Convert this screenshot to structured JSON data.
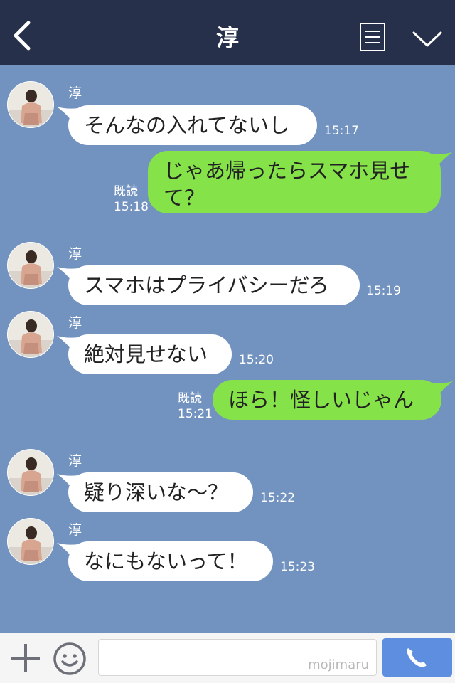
{
  "header": {
    "title": "淳"
  },
  "messages": [
    {
      "direction": "in",
      "sender": "淳",
      "text": "そんなの入れてないし",
      "time": "15:17"
    },
    {
      "direction": "out",
      "read": "既読",
      "text": "じゃあ帰ったらスマホ見せて？",
      "time": "15:18"
    },
    {
      "direction": "in",
      "sender": "淳",
      "text": "スマホはプライバシーだろ",
      "time": "15:19"
    },
    {
      "direction": "in",
      "sender": "淳",
      "text": "絶対見せない",
      "time": "15:20"
    },
    {
      "direction": "out",
      "read": "既読",
      "text": "ほら！怪しいじゃん",
      "time": "15:21"
    },
    {
      "direction": "in",
      "sender": "淳",
      "text": "疑り深いな〜？",
      "time": "15:22"
    },
    {
      "direction": "in",
      "sender": "淳",
      "text": "なにもないって！",
      "time": "15:23"
    }
  ],
  "footer": {
    "watermark": "mojimaru"
  },
  "colors": {
    "header_bg": "#27304a",
    "chat_bg": "#7293c0",
    "incoming_bubble": "#ffffff",
    "outgoing_bubble": "#85e249",
    "call_button": "#5e8ee0"
  },
  "icons": [
    "back-arrow-icon",
    "menu-list-icon",
    "chevron-down-icon",
    "plus-icon",
    "smiley-icon",
    "phone-icon"
  ]
}
